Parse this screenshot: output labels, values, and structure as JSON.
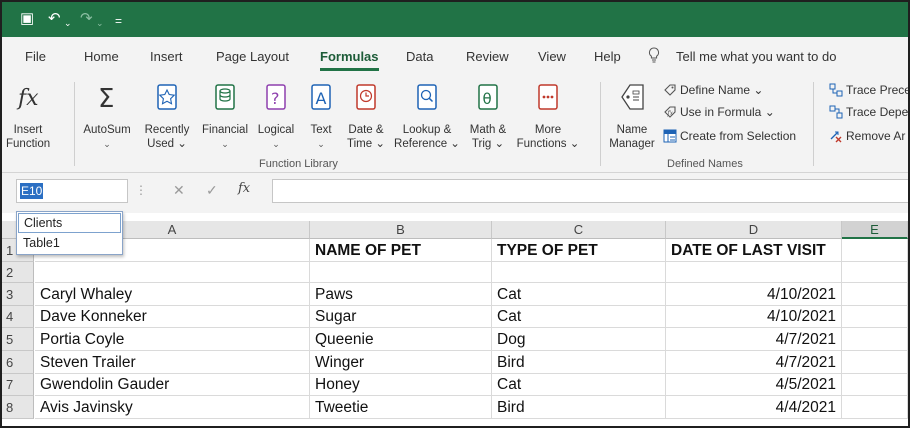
{
  "app": {
    "accent": "#217346"
  },
  "quick_access": [
    {
      "name": "save-icon",
      "glyph": "▣"
    },
    {
      "name": "undo-icon",
      "glyph": "↶"
    },
    {
      "name": "redo-icon",
      "glyph": "↷"
    },
    {
      "name": "customize-icon",
      "glyph": "="
    }
  ],
  "tabs": [
    "File",
    "Home",
    "Insert",
    "Page Layout",
    "Formulas",
    "Data",
    "Review",
    "View",
    "Help"
  ],
  "active_tab": "Formulas",
  "tell_me": "Tell me what you want to do",
  "ribbon": {
    "function_library": {
      "label": "Function Library",
      "buttons": [
        {
          "line1": "Insert",
          "line2": "Function",
          "icon": "fx-icon"
        },
        {
          "line1": "AutoSum",
          "line2": "⌄",
          "icon": "sigma-icon"
        },
        {
          "line1": "Recently",
          "line2": "Used ⌄",
          "icon": "star-book-icon"
        },
        {
          "line1": "Financial",
          "line2": "⌄",
          "icon": "coins-book-icon"
        },
        {
          "line1": "Logical",
          "line2": "⌄",
          "icon": "question-book-icon"
        },
        {
          "line1": "Text",
          "line2": "⌄",
          "icon": "text-book-icon"
        },
        {
          "line1": "Date &",
          "line2": "Time ⌄",
          "icon": "clock-book-icon"
        },
        {
          "line1": "Lookup &",
          "line2": "Reference ⌄",
          "icon": "magnifier-book-icon"
        },
        {
          "line1": "Math &",
          "line2": "Trig ⌄",
          "icon": "theta-book-icon"
        },
        {
          "line1": "More",
          "line2": "Functions ⌄",
          "icon": "dots-book-icon"
        }
      ]
    },
    "defined_names": {
      "label": "Defined Names",
      "name_manager_line1": "Name",
      "name_manager_line2": "Manager",
      "define_name": "Define Name ⌄",
      "use_in_formula": "Use in Formula ⌄",
      "create_from_selection": "Create from Selection"
    },
    "auditing": {
      "trace_precedents": "Trace Prece",
      "trace_dependents": "Trace Depe",
      "remove_arrows": "Remove Ar"
    }
  },
  "formula_bar": {
    "name_box": "E10",
    "dots": "⋮",
    "cancel": "✕",
    "enter": "✓",
    "fx": "fx",
    "value": ""
  },
  "name_dropdown": [
    "Clients",
    "Table1"
  ],
  "sheet": {
    "columns": [
      "A",
      "B",
      "C",
      "D",
      "E"
    ],
    "selected_column": "E",
    "rows": [
      {
        "num": "1",
        "cells": [
          "",
          "NAME OF PET",
          "TYPE OF PET",
          "DATE OF LAST VISIT",
          ""
        ]
      },
      {
        "num": "2",
        "cells": [
          "",
          "",
          "",
          "",
          ""
        ]
      },
      {
        "num": "3",
        "cells": [
          "Caryl Whaley",
          "Paws",
          "Cat",
          "4/10/2021",
          ""
        ]
      },
      {
        "num": "4",
        "cells": [
          "Dave Konneker",
          "Sugar",
          "Cat",
          "4/10/2021",
          ""
        ]
      },
      {
        "num": "5",
        "cells": [
          "Portia Coyle",
          "Queenie",
          "Dog",
          "4/7/2021",
          ""
        ]
      },
      {
        "num": "6",
        "cells": [
          "Steven Trailer",
          "Winger",
          "Bird",
          "4/7/2021",
          ""
        ]
      },
      {
        "num": "7",
        "cells": [
          "Gwendolin Gauder",
          "Honey",
          "Cat",
          "4/5/2021",
          ""
        ]
      },
      {
        "num": "8",
        "cells": [
          "Avis Javinsky",
          "Tweetie",
          "Bird",
          "4/4/2021",
          ""
        ]
      }
    ]
  }
}
